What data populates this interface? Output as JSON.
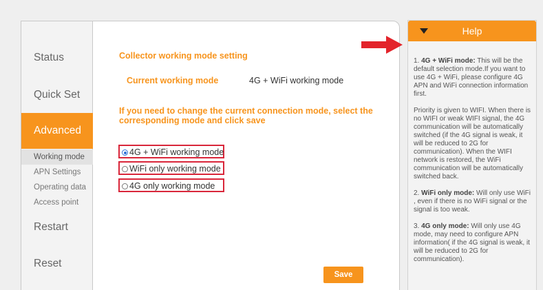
{
  "sidebar": {
    "main": [
      {
        "label": "Status"
      },
      {
        "label": "Quick Set"
      },
      {
        "label": "Advanced"
      },
      {
        "label": "Restart"
      },
      {
        "label": "Reset"
      }
    ],
    "sub": [
      {
        "label": "Working mode"
      },
      {
        "label": "APN Settings"
      },
      {
        "label": "Operating data"
      },
      {
        "label": "Access point"
      }
    ],
    "active_main": "Advanced",
    "active_sub": "Working mode"
  },
  "content": {
    "title": "Collector working mode setting",
    "current_label": "Current working mode",
    "current_value": "4G + WiFi working mode",
    "instruction": "If you need to change the current connection mode, select the corresponding mode and click save",
    "options": [
      {
        "label": "4G + WiFi working mode",
        "selected": true
      },
      {
        "label": "WiFi only working mode",
        "selected": false
      },
      {
        "label": "4G only working mode",
        "selected": false
      }
    ],
    "save_label": "Save"
  },
  "help": {
    "title": "Help",
    "items": [
      {
        "num": "1.",
        "head": "4G + WiFi mode:",
        "text": " This will be the default selection mode.If you want to use 4G + WiFi, please configure 4G APN and WiFi connection information first."
      },
      {
        "num": "",
        "head": "",
        "text": "Priority is given to WIFI. When there is no WIFI or weak WIFI signal, the 4G communication will be automatically switched (if the 4G signal is weak, it will be reduced to 2G for communication). When the WIFI network is restored, the WiFi communication will be automatically switched back."
      },
      {
        "num": "2.",
        "head": "WiFi only mode:",
        "text": " Will only use WiFi , even if there is no WiFi signal or the signal is too weak."
      },
      {
        "num": "3.",
        "head": "4G only mode:",
        "text": " Will only use 4G mode, may need to configure APN information( if the 4G signal is weak, it will be reduced to 2G for communication)."
      }
    ]
  },
  "colors": {
    "accent": "#f7941d",
    "highlight_border": "#d9263a",
    "arrow": "#e3242b",
    "sidebar_bg": "#f3f3f3"
  },
  "icons": {
    "arrow": "red-arrow-icon",
    "collapse": "triangle-down-icon",
    "radio": "radio-icon"
  }
}
